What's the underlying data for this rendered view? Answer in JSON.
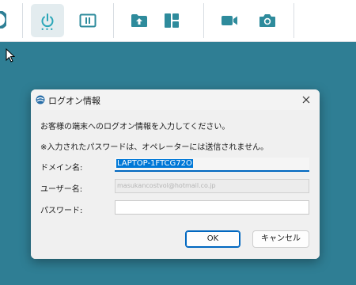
{
  "dialog": {
    "title": "ログオン情報",
    "message_1": "お客様の端末へのログオン情報を入力してください。",
    "message_2": "※入力されたパスワードは、オペレーターには送信されません。",
    "domain_label": "ドメイン名:",
    "domain_value": "LAPTOP-1FTCG72O",
    "user_label": "ユーザー名:",
    "user_value": "masukancostvol@hotmail.co.jp",
    "password_label": "パスワード:",
    "password_value": "",
    "ok_label": "OK",
    "cancel_label": "キャンセル"
  },
  "toolbar": {
    "buttons": [
      "power-icon",
      "pause-icon",
      "folder-upload-icon",
      "layout-icon",
      "video-camera-icon",
      "camera-icon"
    ],
    "power_status": "•••"
  },
  "colors": {
    "desktop": "#2f7e94",
    "accent": "#0067c0",
    "icon": "#2e8b9c",
    "power_icon": "#2aa6b8"
  }
}
